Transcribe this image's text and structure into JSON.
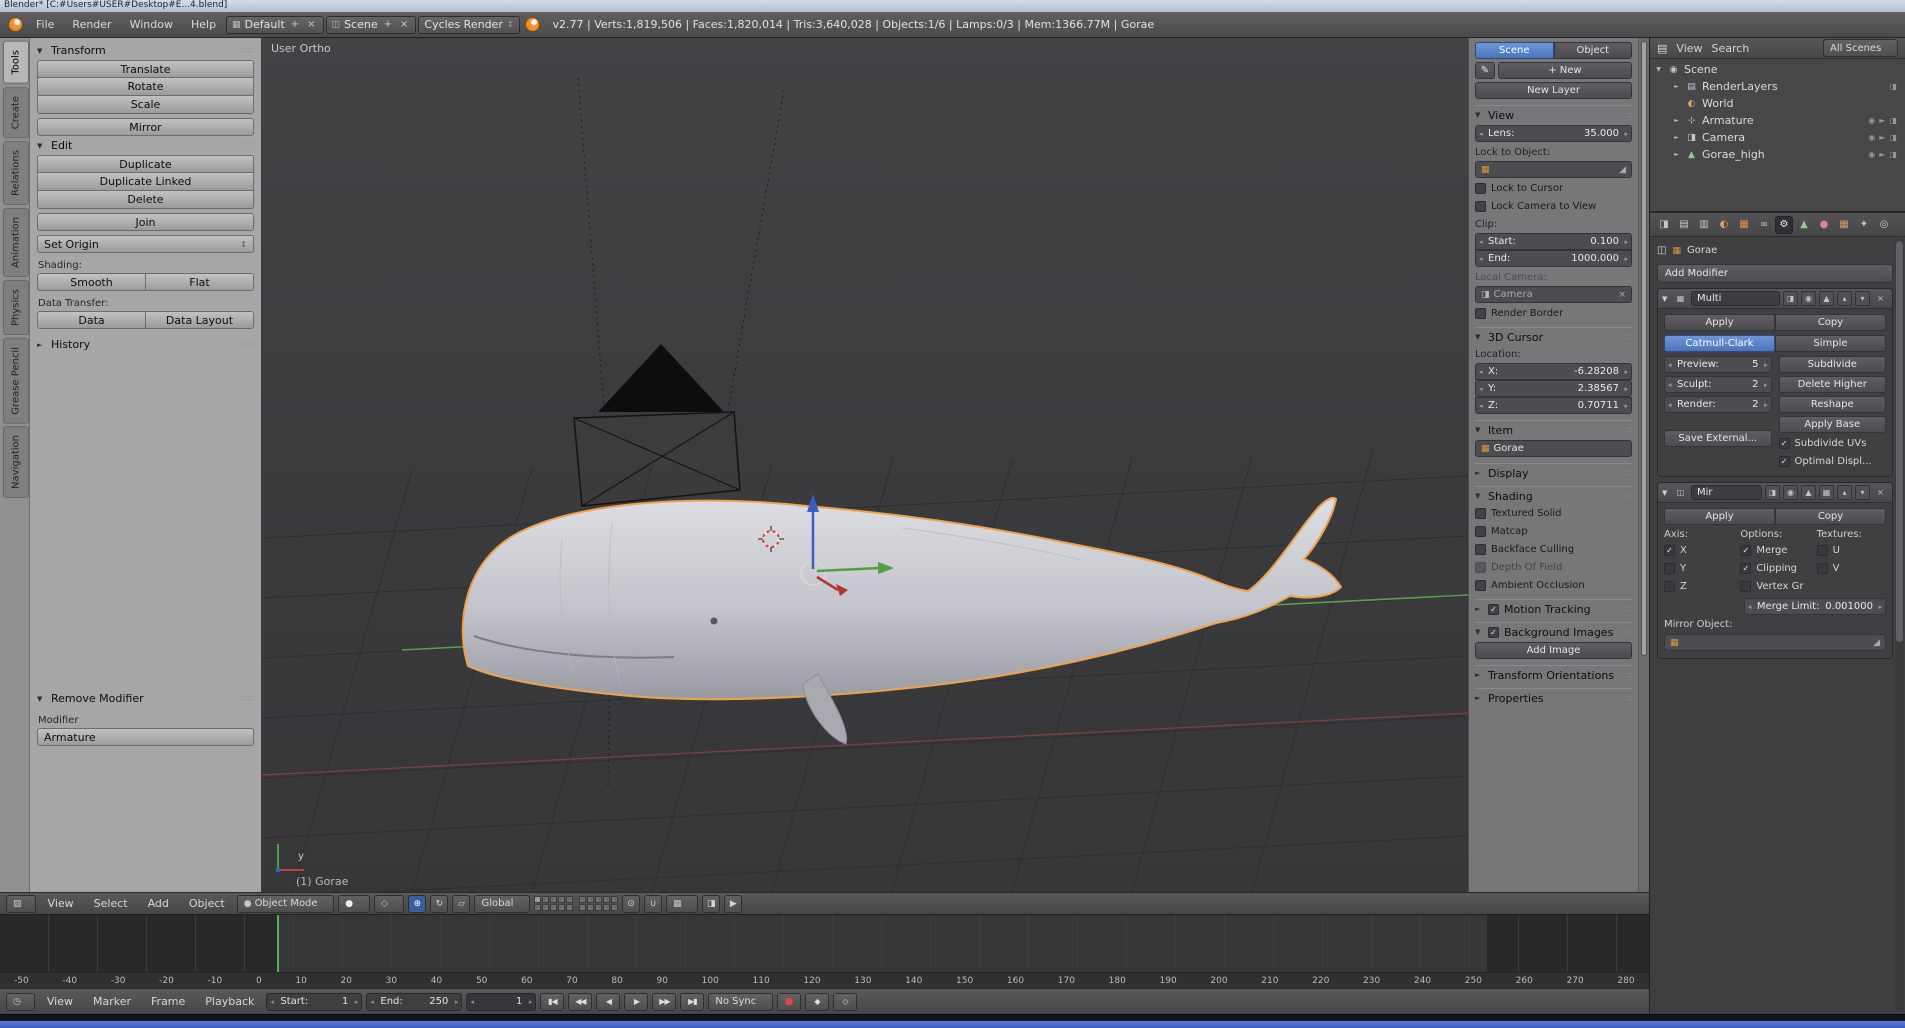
{
  "colors": {
    "accent_blue": "#4b74ba",
    "selection_orange": "#f0a14e",
    "axis_green": "#5e9e4d",
    "axis_red": "#b04a4a",
    "playhead_green": "#53b552",
    "record_red": "#e04848"
  },
  "titlebar": {
    "text": "Blender* [C:#Users#USER#Desktop#E...4.blend]"
  },
  "topbar": {
    "menus": [
      "File",
      "Render",
      "Window",
      "Help"
    ],
    "layout": {
      "value": "Default",
      "add": "+",
      "close": "×"
    },
    "scene": {
      "value": "Scene",
      "add": "+",
      "close": "×"
    },
    "engine": {
      "value": "Cycles Render"
    },
    "stats": "v2.77 | Verts:1,819,506 | Faces:1,820,014 | Tris:3,640,028 | Objects:1/6 | Lamps:0/3 | Mem:1366.77M | Gorae"
  },
  "toolshelf": {
    "tabs": [
      {
        "label": "Tools"
      },
      {
        "label": "Create"
      },
      {
        "label": "Relations"
      },
      {
        "label": "Animation"
      },
      {
        "label": "Physics"
      },
      {
        "label": "Grease Pencil"
      },
      {
        "label": "Navigation"
      }
    ],
    "transform": {
      "title": "Transform",
      "b1": "Translate",
      "b2": "Rotate",
      "b3": "Scale",
      "b4": "Mirror"
    },
    "edit": {
      "title": "Edit",
      "b1": "Duplicate",
      "b2": "Duplicate Linked",
      "b3": "Delete",
      "b4": "Join",
      "set_origin": "Set Origin"
    },
    "shading_label": "Shading:",
    "smooth": "Smooth",
    "flat": "Flat",
    "data_transfer_label": "Data Transfer:",
    "data": "Data",
    "data_layout": "Data Layout",
    "history_title": "History",
    "remove_modifier": {
      "title": "Remove Modifier",
      "label": "Modifier",
      "value": "Armature"
    }
  },
  "viewport": {
    "view_label": "User Ortho",
    "object_info": "(1) Gorae",
    "axis_y_label": "y",
    "header": {
      "menus": [
        "View",
        "Select",
        "Add",
        "Object"
      ],
      "mode": "Object Mode",
      "orientation": "Global"
    }
  },
  "npanel": {
    "gp_source_scene": "Scene",
    "gp_source_object": "Object",
    "gp_new": "New",
    "new_layer": "New Layer",
    "view": {
      "title": "View",
      "lens_label": "Lens:",
      "lens_value": "35.000",
      "lock_object_label": "Lock to Object:",
      "lock_cursor_label": "Lock to Cursor",
      "lock_camera_label": "Lock Camera to View",
      "clip_label": "Clip:",
      "clip_start_label": "Start:",
      "clip_start": "0.100",
      "clip_end_label": "End:",
      "clip_end": "1000.000",
      "local_camera_label": "Local Camera:",
      "local_camera_value": "Camera",
      "render_border_label": "Render Border"
    },
    "cursor": {
      "title": "3D Cursor",
      "location_label": "Location:",
      "x_label": "X:",
      "x": "-6.28208",
      "y_label": "Y:",
      "y": "2.38567",
      "z_label": "Z:",
      "z": "0.70711"
    },
    "item": {
      "title": "Item",
      "name": "Gorae"
    },
    "display_title": "Display",
    "shading": {
      "title": "Shading",
      "options": [
        {
          "label": "Textured Solid",
          "mark": ""
        },
        {
          "label": "Matcap",
          "mark": ""
        },
        {
          "label": "Backface Culling",
          "mark": ""
        },
        {
          "label": "Depth Of Field",
          "mark": ""
        },
        {
          "label": "Ambient Occlusion",
          "mark": ""
        }
      ]
    },
    "motion_tracking": {
      "title": "Motion Tracking",
      "mark": "✓"
    },
    "background_images": {
      "title": "Background Images",
      "mark": "✓",
      "add_image": "Add Image"
    },
    "transform_orientations_title": "Transform Orientations",
    "properties_title": "Properties"
  },
  "outliner": {
    "header": {
      "view": "View",
      "search": "Search",
      "scope": "All Scenes"
    },
    "rows": [
      {
        "label": "Scene"
      },
      {
        "label": "RenderLayers"
      },
      {
        "label": "World"
      },
      {
        "label": "Armature"
      },
      {
        "label": "Camera"
      },
      {
        "label": "Gorae_high"
      }
    ]
  },
  "properties": {
    "breadcrumb": "Gorae",
    "add_modifier": "Add Modifier",
    "multires": {
      "name": "Multi",
      "apply": "Apply",
      "copy": "Copy",
      "catmull": "Catmull-Clark",
      "simple": "Simple",
      "preview_label": "Preview:",
      "preview": "5",
      "sculpt_label": "Sculpt:",
      "sculpt": "2",
      "render_label": "Render:",
      "render": "2",
      "subdivide": "Subdivide",
      "delete_higher": "Delete Higher",
      "reshape": "Reshape",
      "apply_base": "Apply Base",
      "subdivide_uvs": {
        "label": "Subdivide UVs",
        "mark": "✓"
      },
      "optimal_display": {
        "label": "Optimal Displ...",
        "mark": "✓"
      },
      "save_external": "Save External..."
    },
    "mirror": {
      "name": "Mir",
      "apply": "Apply",
      "copy": "Copy",
      "axis_label": "Axis:",
      "options_label": "Options:",
      "textures_label": "Textures:",
      "axis_x": {
        "label": "X",
        "mark": "✓"
      },
      "axis_y": {
        "label": "Y",
        "mark": ""
      },
      "axis_z": {
        "label": "Z",
        "mark": ""
      },
      "merge": {
        "label": "Merge",
        "mark": "✓"
      },
      "clipping": {
        "label": "Clipping",
        "mark": "✓"
      },
      "vertex_groups": {
        "label": "Vertex Gr",
        "mark": ""
      },
      "tex_u": {
        "label": "U",
        "mark": ""
      },
      "tex_v": {
        "label": "V",
        "mark": ""
      },
      "merge_limit_label": "Merge Limit:",
      "merge_limit": "0.001000",
      "mirror_object_label": "Mirror Object:"
    }
  },
  "timeline": {
    "menus": [
      "View",
      "Marker",
      "Frame",
      "Playback"
    ],
    "start_label": "Start:",
    "start": "1",
    "end_label": "End:",
    "end": "250",
    "current": "1",
    "sync": "No Sync",
    "ruler": [
      "-50",
      "-40",
      "-30",
      "-20",
      "-10",
      "0",
      "10",
      "20",
      "30",
      "40",
      "50",
      "60",
      "70",
      "80",
      "90",
      "100",
      "110",
      "120",
      "130",
      "140",
      "150",
      "160",
      "170",
      "180",
      "190",
      "200",
      "210",
      "220",
      "230",
      "240",
      "250",
      "260",
      "270",
      "280"
    ]
  },
  "icons": {
    "dropdown": "↕",
    "plus": "+",
    "close": "×",
    "screen": "▦",
    "scene_data": "◫",
    "pencil": "✎",
    "eyedropper": "◢",
    "cube": "▦",
    "camera": "◨",
    "collapse": "▼",
    "expand": "►",
    "eye": "◉",
    "cursor_arrow": "►",
    "editor_3d": "▧",
    "editor_timeline": "◷",
    "mode_dot": "●",
    "shading_sphere": "●",
    "pivot": "◇",
    "manip_translate": "⊕",
    "manip_rotate": "↻",
    "manip_scale": "▱",
    "lock": "⊙",
    "magnet": "∪",
    "snap_element": "▦",
    "render_still": "◨",
    "render_anim": "▶",
    "outliner_icon": "▤",
    "scene_obj": "◉",
    "renderlayers": "▤",
    "world": "◐",
    "armature": "⊹",
    "mesh": "▲",
    "tab_render": "◨",
    "tab_layers": "▤",
    "tab_scene": "▥",
    "constraint": "∞",
    "wrench": "⚙",
    "data_mesh": "▲",
    "material": "●",
    "texture": "▦",
    "particles": "✦",
    "physics": "◎",
    "up": "▴",
    "down": "▾",
    "jump_start": "▮◀",
    "prev_key": "◀◀",
    "play_rev": "◀",
    "play": "▶",
    "next_key": "▶▶",
    "jump_end": "▶▮",
    "record": "●",
    "key_diamond": "◆",
    "key_diamond_open": "◇"
  }
}
